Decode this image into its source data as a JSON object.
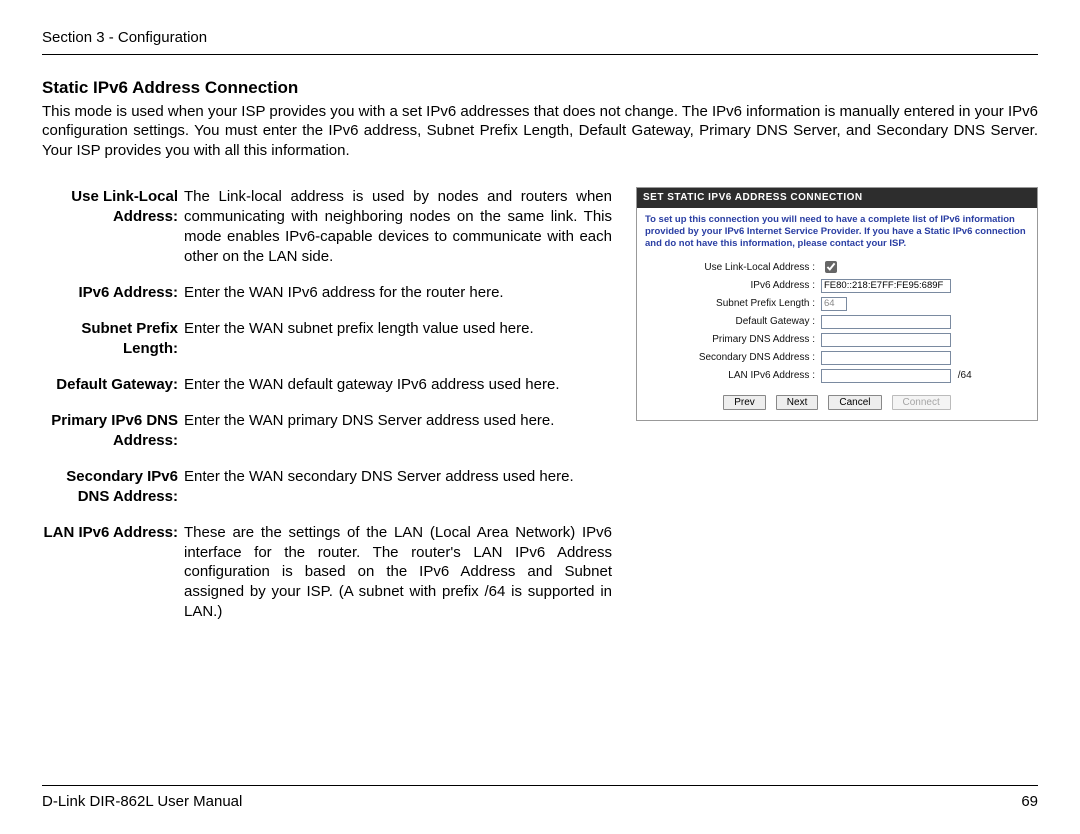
{
  "header": {
    "section": "Section 3 - Configuration"
  },
  "title": "Static IPv6 Address Connection",
  "intro": "This mode is used when your ISP provides you with a set IPv6 addresses that does not change. The IPv6 information is manually entered in your IPv6 configuration settings. You must enter the IPv6 address, Subnet Prefix Length, Default Gateway, Primary DNS Server, and Secondary DNS Server. Your ISP provides you with all this information.",
  "defs": [
    {
      "term": "Use Link-Local\nAddress:",
      "desc": "The Link-local address is used by nodes and routers when communicating with neighboring nodes on the same link. This mode enables IPv6-capable devices to communicate with each other on the LAN side."
    },
    {
      "term": "IPv6 Address:",
      "desc": "Enter the WAN IPv6 address for the router here."
    },
    {
      "term": "Subnet Prefix\nLength:",
      "desc": "Enter the WAN subnet prefix length value used here."
    },
    {
      "term": "Default Gateway:",
      "desc": "Enter the WAN default gateway IPv6 address used here."
    },
    {
      "term": "Primary IPv6 DNS\nAddress:",
      "desc": "Enter the WAN primary DNS Server address used here."
    },
    {
      "term": "Secondary IPv6\nDNS Address:",
      "desc": "Enter the WAN secondary DNS Server address used here."
    },
    {
      "term": "LAN IPv6 Address:",
      "desc": "These are the settings of the LAN (Local Area Network) IPv6 interface for the router. The router's LAN IPv6 Address configuration is based on the IPv6 Address and Subnet assigned by your ISP. (A subnet with prefix /64 is supported in LAN.)"
    }
  ],
  "shot": {
    "title": "SET STATIC IPV6 ADDRESS CONNECTION",
    "note": "To set up this connection you will need to have a complete list of IPv6 information provided by your IPv6 Internet Service Provider. If you have a Static IPv6 connection and do not have this information, please contact your ISP.",
    "fields": {
      "use_link_local": {
        "label": "Use Link-Local Address :",
        "checked": true
      },
      "ipv6_address": {
        "label": "IPv6 Address :",
        "value": "FE80::218:E7FF:FE95:689F"
      },
      "subnet_prefix": {
        "label": "Subnet Prefix Length :",
        "value": "64"
      },
      "default_gw": {
        "label": "Default Gateway :",
        "value": ""
      },
      "primary_dns": {
        "label": "Primary DNS Address :",
        "value": ""
      },
      "secondary_dns": {
        "label": "Secondary DNS Address :",
        "value": ""
      },
      "lan_ipv6": {
        "label": "LAN IPv6 Address :",
        "value": "",
        "suffix": "/64"
      }
    },
    "buttons": {
      "prev": "Prev",
      "next": "Next",
      "cancel": "Cancel",
      "connect": "Connect"
    }
  },
  "footer": {
    "left": "D-Link DIR-862L User Manual",
    "right": "69"
  }
}
